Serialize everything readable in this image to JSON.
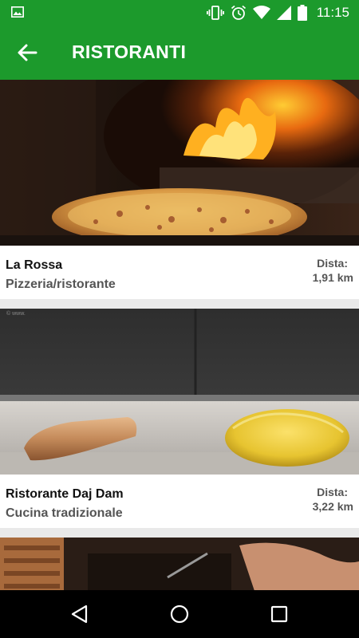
{
  "status_bar": {
    "time": "11:15",
    "icons": [
      "image-icon",
      "vibrate-icon",
      "alarm-icon",
      "wifi-icon",
      "signal-icon",
      "battery-icon"
    ]
  },
  "app_bar": {
    "title": "RISTORANTI",
    "back_icon": "arrow-back-icon"
  },
  "colors": {
    "primary": "#1c9a2c",
    "list_background": "#e9e9e9",
    "card_background": "#ffffff",
    "secondary_text": "#555555"
  },
  "restaurants": [
    {
      "name": "La Rossa",
      "type": "Pizzeria/ristorante",
      "distance_label": "Dista:",
      "distance_value": "1,91 km",
      "image": "pizza-oven-photo"
    },
    {
      "name": "Ristorante Daj Dam",
      "type": "Cucina tradizionale",
      "distance_label": "Dista:",
      "distance_value": "3,22 km",
      "image": "pasta-dough-photo"
    },
    {
      "image": "kitchen-photo"
    }
  ],
  "nav_bar": {
    "buttons": [
      "back-triangle-icon",
      "home-circle-icon",
      "recents-square-icon"
    ]
  }
}
